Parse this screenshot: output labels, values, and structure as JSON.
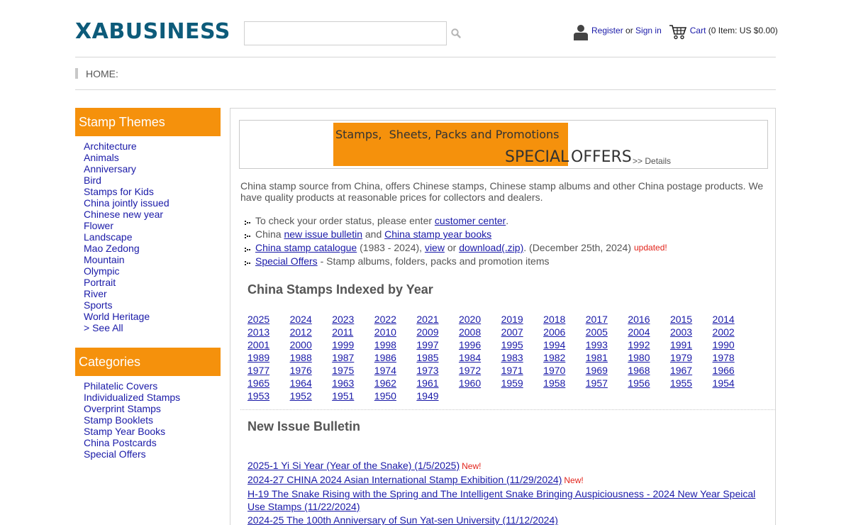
{
  "header": {
    "logo": "XABUSINESS",
    "search_value": "",
    "register": "Register",
    "or": "or",
    "sign_in": "Sign in",
    "cart": "Cart",
    "cart_summary": "(0 Item: US $0.00)"
  },
  "breadcrumb": {
    "home": "HOME:"
  },
  "sidebar": {
    "themes_title": "Stamp Themes",
    "themes": [
      "Architecture",
      "Animals",
      "Anniversary",
      "Bird",
      "Stamps for Kids",
      "China jointly issued",
      "Chinese new year",
      "Flower",
      "Landscape",
      "Mao Zedong",
      "Mountain",
      "Olympic",
      "Portrait",
      "River",
      "Sports",
      "World Heritage",
      "> See All"
    ],
    "categories_title": "Categories",
    "categories": [
      "Philatelic Covers",
      "Individualized Stamps",
      "Overprint Stamps",
      "Stamp Booklets",
      "Stamp Year Books",
      "China Postcards",
      "Special Offers"
    ]
  },
  "banner": {
    "line1": "Stamps,  Sheets, Packs and Promotions",
    "special": "SPECIAL",
    "offers": "OFFERS",
    "details": ">> Details",
    "accent": "#f5910c"
  },
  "intro": "China stamp source from China, offers Chinese stamps, Chinese stamp albums and other China postage products. We have quality products at reasonable prices for collectors and dealers.",
  "bullets": {
    "b1_pre": "To check your order status, please enter",
    "b1_link": "customer center",
    "b1_post": ".",
    "b2_pre": "China",
    "b2_link1": "new issue bulletin",
    "b2_mid": "and",
    "b2_link2": "China stamp year books",
    "b3_link1": "China stamp catalogue",
    "b3_mid1": "(1983 - 2024),",
    "b3_link2": "view",
    "b3_mid2": "or",
    "b3_link3": "download(.zip)",
    "b3_post": ". (December 25th, 2024)",
    "b3_updated": "updated!",
    "b4_link": "Special Offers",
    "b4_post": "- Stamp albums, folders, packs and promotion items"
  },
  "years_title": "China Stamps Indexed by Year",
  "years": [
    "2025",
    "2024",
    "2023",
    "2022",
    "2021",
    "2020",
    "2019",
    "2018",
    "2017",
    "2016",
    "2015",
    "2014",
    "2013",
    "2012",
    "2011",
    "2010",
    "2009",
    "2008",
    "2007",
    "2006",
    "2005",
    "2004",
    "2003",
    "2002",
    "2001",
    "2000",
    "1999",
    "1998",
    "1997",
    "1996",
    "1995",
    "1994",
    "1993",
    "1992",
    "1991",
    "1990",
    "1989",
    "1988",
    "1987",
    "1986",
    "1985",
    "1984",
    "1983",
    "1982",
    "1981",
    "1980",
    "1979",
    "1978",
    "1977",
    "1976",
    "1975",
    "1974",
    "1973",
    "1972",
    "1971",
    "1970",
    "1969",
    "1968",
    "1967",
    "1966",
    "1965",
    "1964",
    "1963",
    "1962",
    "1961",
    "1960",
    "1959",
    "1958",
    "1957",
    "1956",
    "1955",
    "1954",
    "1953",
    "1952",
    "1951",
    "1950",
    "1949"
  ],
  "bulletin_title": "New Issue Bulletin",
  "bulletin": [
    {
      "text": "2025-1 Yi Si Year (Year of the Snake) (1/5/2025)",
      "badge": "New!"
    },
    {
      "text": "2024-27 CHINA 2024 Asian International Stamp Exhibition (11/29/2024)",
      "badge": "New!"
    },
    {
      "text": "H-19 The Snake Rising with the Spring and The Intelligent Snake Bringing Auspiciousness - 2024 New Year Speical Use Stamps (11/22/2024)",
      "badge": ""
    },
    {
      "text": "2024-25 The 100th Anniversary of Sun Yat-sen University (11/12/2024)",
      "badge": ""
    }
  ]
}
